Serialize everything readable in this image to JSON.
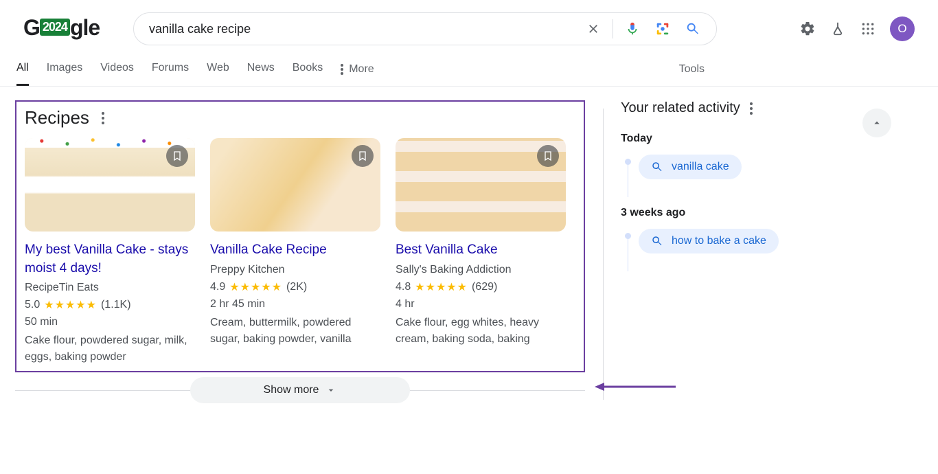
{
  "logo": {
    "badge": "2024",
    "rest": "gle"
  },
  "search": {
    "query": "vanilla cake recipe"
  },
  "avatar_initial": "O",
  "nav": {
    "tabs": [
      "All",
      "Images",
      "Videos",
      "Forums",
      "Web",
      "News",
      "Books"
    ],
    "more": "More",
    "tools": "Tools",
    "active": "All"
  },
  "recipes": {
    "heading": "Recipes",
    "show_more": "Show more",
    "cards": [
      {
        "title": "My best Vanilla Cake - stays moist 4 days!",
        "source": "RecipeTin Eats",
        "rating_value": "5.0",
        "rating_count": "(1.1K)",
        "cook_time": "50 min",
        "ingredients": "Cake flour, powdered sugar, milk, eggs, baking powder"
      },
      {
        "title": "Vanilla Cake Recipe",
        "source": "Preppy Kitchen",
        "rating_value": "4.9",
        "rating_count": "(2K)",
        "cook_time": "2 hr 45 min",
        "ingredients": "Cream, buttermilk, powdered sugar, baking powder, vanilla"
      },
      {
        "title": "Best Vanilla Cake",
        "source": "Sally's Baking Addiction",
        "rating_value": "4.8",
        "rating_count": "(629)",
        "cook_time": "4 hr",
        "ingredients": "Cake flour, egg whites, heavy cream, baking soda, baking"
      }
    ]
  },
  "related": {
    "heading": "Your related activity",
    "sections": [
      {
        "label": "Today",
        "items": [
          "vanilla cake"
        ]
      },
      {
        "label": "3 weeks ago",
        "items": [
          "how to bake a cake"
        ]
      }
    ]
  }
}
